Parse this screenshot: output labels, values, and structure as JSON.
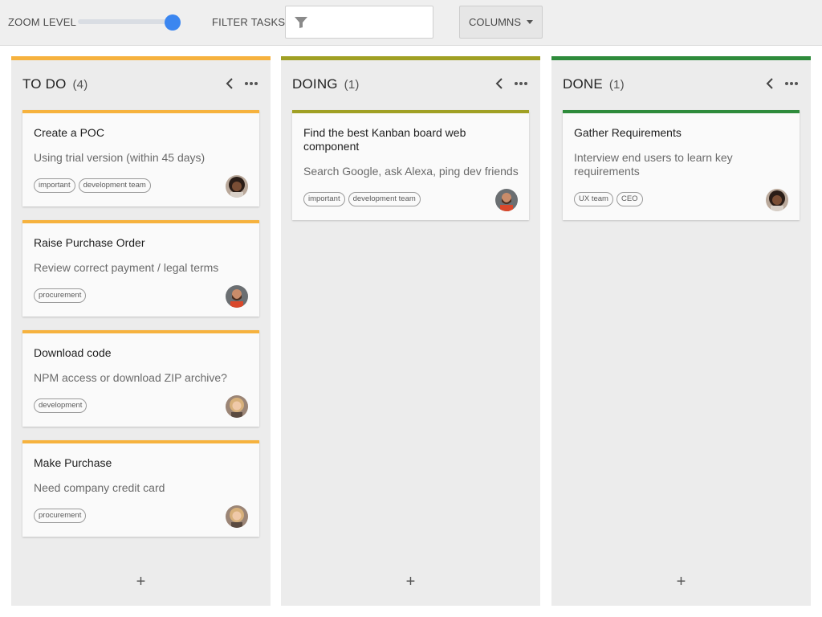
{
  "toolbar": {
    "zoom_label": "ZOOM LEVEL",
    "filter_label": "FILTER TASKS",
    "filter_value": "",
    "columns_label": "COLUMNS",
    "filter_icon": "funnel-icon",
    "columns_caret_icon": "caret-down-icon"
  },
  "columns": [
    {
      "title": "TO DO",
      "count": "(4)",
      "accent": "#f6b23e",
      "collapse_icon": "chevron-left-icon",
      "more_icon": "more-horizontal-icon",
      "add_label": "+",
      "cards": [
        {
          "title": "Create a POC",
          "description": "Using trial version (within 45 days)",
          "tags": [
            "important",
            "development team"
          ],
          "avatar": "avatar-woman-dark-hair"
        },
        {
          "title": "Raise Purchase Order",
          "description": "Review correct payment / legal terms",
          "tags": [
            "procurement"
          ],
          "avatar": "avatar-man-beard"
        },
        {
          "title": "Download code",
          "description": "NPM access or download ZIP archive?",
          "tags": [
            "development"
          ],
          "avatar": "avatar-woman-blonde"
        },
        {
          "title": "Make Purchase",
          "description": "Need company credit card",
          "tags": [
            "procurement"
          ],
          "avatar": "avatar-woman-blonde"
        }
      ]
    },
    {
      "title": "DOING",
      "count": "(1)",
      "accent": "#a0a024",
      "collapse_icon": "chevron-left-icon",
      "more_icon": "more-horizontal-icon",
      "add_label": "+",
      "cards": [
        {
          "title": "Find the best Kanban board web component",
          "description": "Search Google, ask Alexa, ping dev friends",
          "tags": [
            "important",
            "development team"
          ],
          "avatar": "avatar-man-beard"
        }
      ]
    },
    {
      "title": "DONE",
      "count": "(1)",
      "accent": "#2e8b3b",
      "collapse_icon": "chevron-left-icon",
      "more_icon": "more-horizontal-icon",
      "add_label": "+",
      "cards": [
        {
          "title": "Gather Requirements",
          "description": "Interview end users to learn key requirements",
          "tags": [
            "UX team",
            "CEO"
          ],
          "avatar": "avatar-woman-dark-hair"
        }
      ]
    }
  ]
}
